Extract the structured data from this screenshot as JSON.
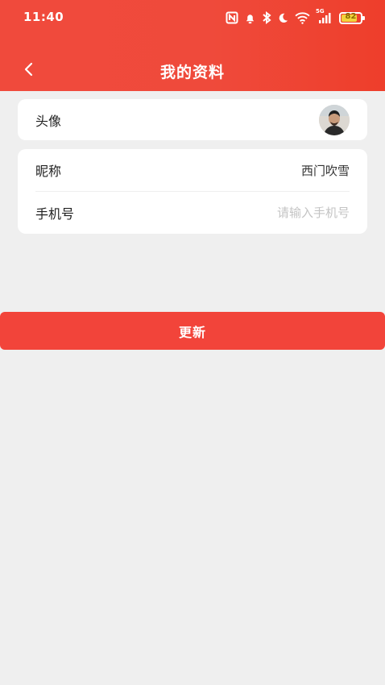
{
  "status_bar": {
    "time": "11:40",
    "network_label": "5G",
    "battery_level": "82",
    "battery_fraction": 0.82,
    "icons": [
      "nfc-icon",
      "bell-icon",
      "bluetooth-icon",
      "moon-icon",
      "wifi-icon",
      "signal-icon",
      "battery-icon"
    ]
  },
  "header": {
    "title": "我的资料",
    "back_icon": "chevron-left-icon",
    "gradient_colors": [
      "#f04a3c",
      "#ee3e2b"
    ]
  },
  "profile": {
    "avatar_label": "头像",
    "nickname_label": "昵称",
    "nickname_value": "西门吹雪",
    "phone_label": "手机号",
    "phone_value": "",
    "phone_placeholder": "请输入手机号"
  },
  "actions": {
    "update_label": "更新",
    "accent_color": "#f2443a"
  }
}
